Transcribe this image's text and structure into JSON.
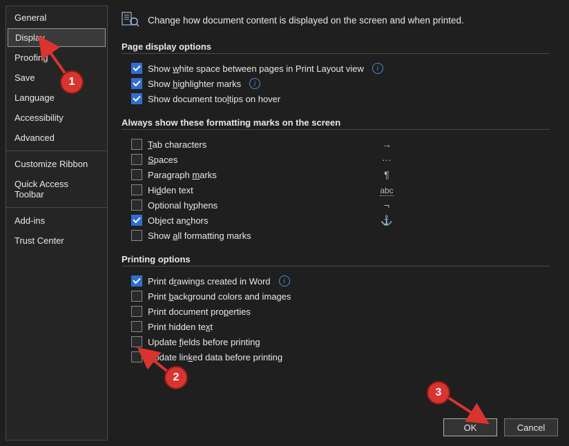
{
  "sidebar": {
    "items": [
      {
        "label": "General"
      },
      {
        "label": "Display",
        "selected": true
      },
      {
        "label": "Proofing"
      },
      {
        "label": "Save"
      },
      {
        "label": "Language"
      },
      {
        "label": "Accessibility"
      },
      {
        "label": "Advanced"
      }
    ],
    "group2": [
      {
        "label": "Customize Ribbon"
      },
      {
        "label": "Quick Access Toolbar"
      }
    ],
    "group3": [
      {
        "label": "Add-ins"
      },
      {
        "label": "Trust Center"
      }
    ]
  },
  "header": {
    "text": "Change how document content is displayed on the screen and when printed."
  },
  "sections": {
    "page_display": {
      "title": "Page display options",
      "options": [
        {
          "label_pre": "Show ",
          "ul": "w",
          "label_post": "hite space between pages in Print Layout view",
          "checked": true,
          "info": true
        },
        {
          "label_pre": "Show ",
          "ul": "h",
          "label_post": "ighlighter marks",
          "checked": true,
          "info": true
        },
        {
          "label_pre": "Show document too",
          "ul": "l",
          "label_post": "tips on hover",
          "checked": true
        }
      ]
    },
    "formatting_marks": {
      "title": "Always show these formatting marks on the screen",
      "options": [
        {
          "ul": "T",
          "label_post": "ab characters",
          "checked": false,
          "symbol": "→"
        },
        {
          "ul": "S",
          "label_post": "paces",
          "checked": false,
          "symbol": "···"
        },
        {
          "label_pre": "Paragraph ",
          "ul": "m",
          "label_post": "arks",
          "checked": false,
          "symbol": "¶"
        },
        {
          "label_pre": "Hi",
          "ul": "d",
          "label_post": "den text",
          "checked": false,
          "symbol_html": "abc",
          "symbol_style": "dotted"
        },
        {
          "label_pre": "Optional h",
          "ul": "y",
          "label_post": "phens",
          "checked": false,
          "symbol": "¬"
        },
        {
          "label_pre": "Object an",
          "ul": "c",
          "label_post": "hors",
          "checked": true,
          "symbol": "⚓"
        },
        {
          "label_pre": "Show ",
          "ul": "a",
          "label_post": "ll formatting marks",
          "checked": false
        }
      ]
    },
    "printing": {
      "title": "Printing options",
      "options": [
        {
          "label_pre": "Print d",
          "ul": "r",
          "label_post": "awings created in Word",
          "checked": true,
          "info": true
        },
        {
          "label_pre": "Print ",
          "ul": "b",
          "label_post": "ackground colors and images",
          "checked": false
        },
        {
          "label_pre": "Print document pro",
          "ul": "p",
          "label_post": "erties",
          "checked": false
        },
        {
          "label_pre": "Print hidden te",
          "ul": "x",
          "label_post": "t",
          "checked": false
        },
        {
          "label_pre": "Update ",
          "ul": "f",
          "label_post": "ields before printing",
          "checked": false
        },
        {
          "label_pre": "Update lin",
          "ul": "k",
          "label_post": "ed data before printing",
          "checked": false
        }
      ]
    }
  },
  "buttons": {
    "ok": "OK",
    "cancel": "Cancel"
  },
  "annotations": {
    "b1": "1",
    "b2": "2",
    "b3": "3"
  }
}
